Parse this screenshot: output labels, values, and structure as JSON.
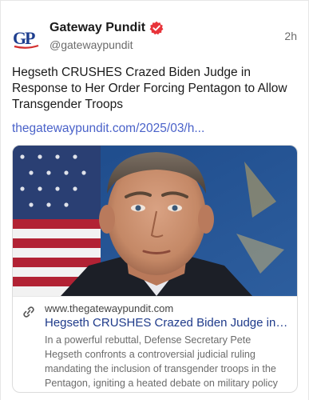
{
  "author": {
    "avatar_text": "GP",
    "name": "Gateway Pundit",
    "handle": "@gatewaypundit",
    "verified_icon": "verified-badge-icon"
  },
  "post": {
    "time": "2h",
    "text": "Hegseth CRUSHES Crazed Biden Judge in Response to Her Order Forcing Pentagon to Allow Transgender Troops",
    "link": "thegatewaypundit.com/2025/03/h..."
  },
  "preview": {
    "domain": "www.thegatewaypundit.com",
    "title": "Hegseth CRUSHES Crazed Biden Judge in Res...",
    "description": "In a powerful rebuttal, Defense Secretary Pete Hegseth confronts a controversial judicial ruling mandating the inclusion of transgender troops in the Pentagon, igniting a heated debate on military policy and identity.",
    "link_icon": "link-icon",
    "image": "portrait-photo"
  },
  "colors": {
    "link": "#4a62c9",
    "preview_title": "#1e3a8a",
    "verified_badge": "#e8343a",
    "avatar_blue": "#1f3f8f",
    "avatar_red": "#d32f2f"
  }
}
